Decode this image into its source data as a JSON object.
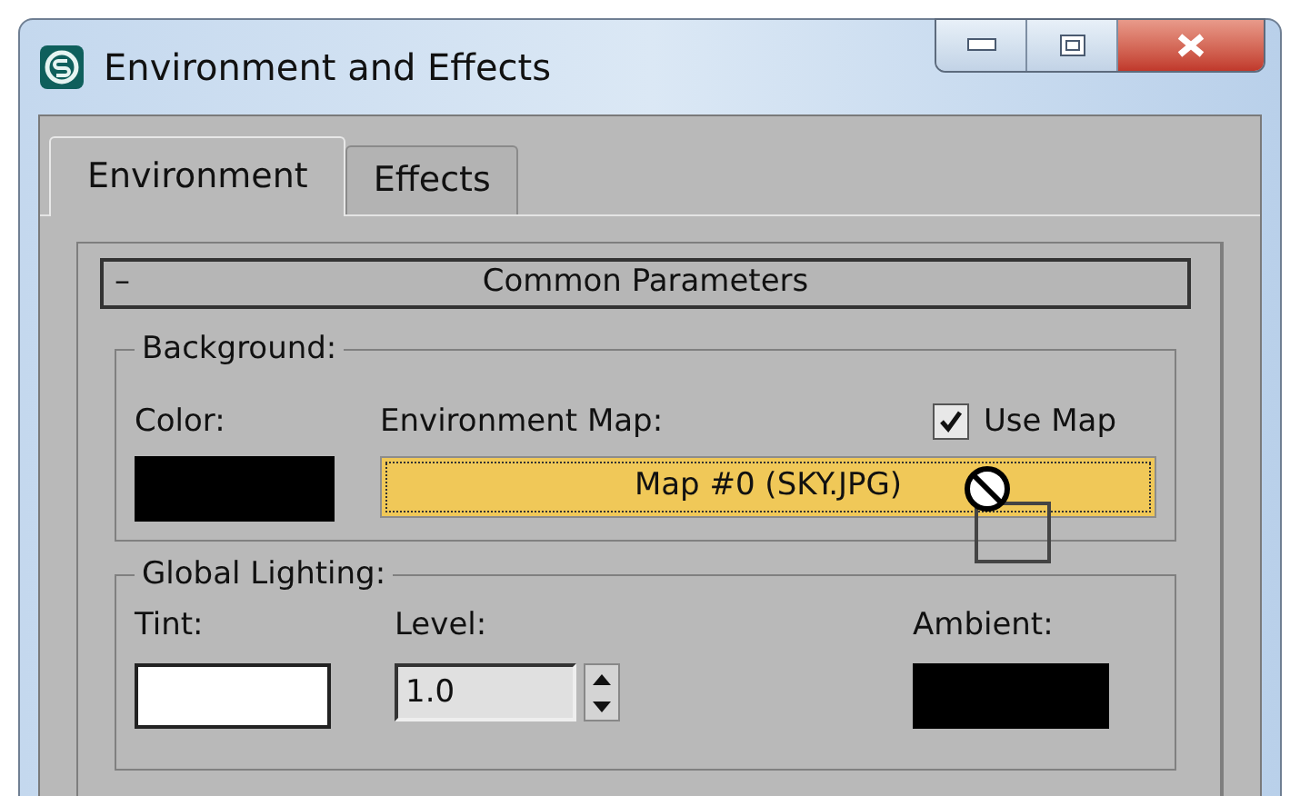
{
  "window": {
    "title": "Environment and Effects"
  },
  "tabs": [
    {
      "label": "Environment",
      "selected": true
    },
    {
      "label": "Effects",
      "selected": false
    }
  ],
  "rollout": {
    "toggle": "–",
    "title": "Common Parameters",
    "expanded": true
  },
  "background": {
    "title": "Background:",
    "color_label": "Color:",
    "color": "#000000",
    "map_label": "Environment Map:",
    "use_map": {
      "label": "Use Map",
      "checked": true
    },
    "map_button": "Map #0 (SKY.JPG)"
  },
  "global_lighting": {
    "title": "Global Lighting:",
    "tint": {
      "label": "Tint:",
      "color": "#ffffff"
    },
    "level_label": "Level:",
    "level_value": "1.0",
    "ambient": {
      "label": "Ambient:",
      "color": "#000000"
    }
  }
}
